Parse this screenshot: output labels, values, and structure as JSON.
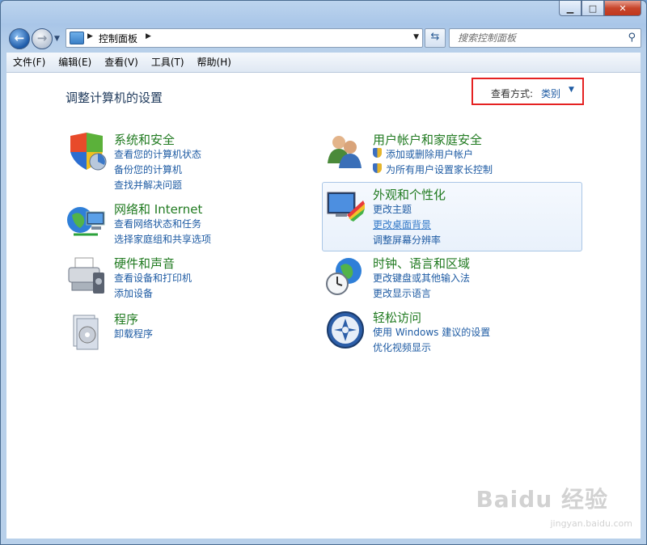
{
  "window": {
    "caption_buttons": [
      "minimize",
      "maximize",
      "close"
    ]
  },
  "address_bar": {
    "breadcrumb": "控制面板",
    "search_placeholder": "搜索控制面板"
  },
  "menu": [
    "文件(F)",
    "编辑(E)",
    "查看(V)",
    "工具(T)",
    "帮助(H)"
  ],
  "main": {
    "headline": "调整计算机的设置",
    "view_by_label": "查看方式:",
    "view_by_value": "类别"
  },
  "categories": [
    {
      "title": "系统和安全",
      "icon": "shield-icon",
      "links": [
        "查看您的计算机状态",
        "备份您的计算机",
        "查找并解决问题"
      ]
    },
    {
      "title": "网络和 Internet",
      "icon": "network-globe-icon",
      "links": [
        "查看网络状态和任务",
        "选择家庭组和共享选项"
      ]
    },
    {
      "title": "硬件和声音",
      "icon": "printer-icon",
      "links": [
        "查看设备和打印机",
        "添加设备"
      ]
    },
    {
      "title": "程序",
      "icon": "program-icon",
      "links": [
        "卸载程序"
      ]
    },
    {
      "title": "用户帐户和家庭安全",
      "icon": "users-icon",
      "links": [
        "添加或删除用户帐户",
        "为所有用户设置家长控制"
      ]
    },
    {
      "title": "外观和个性化",
      "icon": "appearance-icon",
      "links": [
        "更改主题",
        "更改桌面背景",
        "调整屏幕分辨率"
      ]
    },
    {
      "title": "时钟、语言和区域",
      "icon": "clock-globe-icon",
      "links": [
        "更改键盘或其他输入法",
        "更改显示语言"
      ]
    },
    {
      "title": "轻松访问",
      "icon": "ease-of-access-icon",
      "links": [
        "使用 Windows 建议的设置",
        "优化视频显示"
      ]
    }
  ],
  "watermark": {
    "main": "Baidu 经验",
    "sub": "jingyan.baidu.com"
  }
}
